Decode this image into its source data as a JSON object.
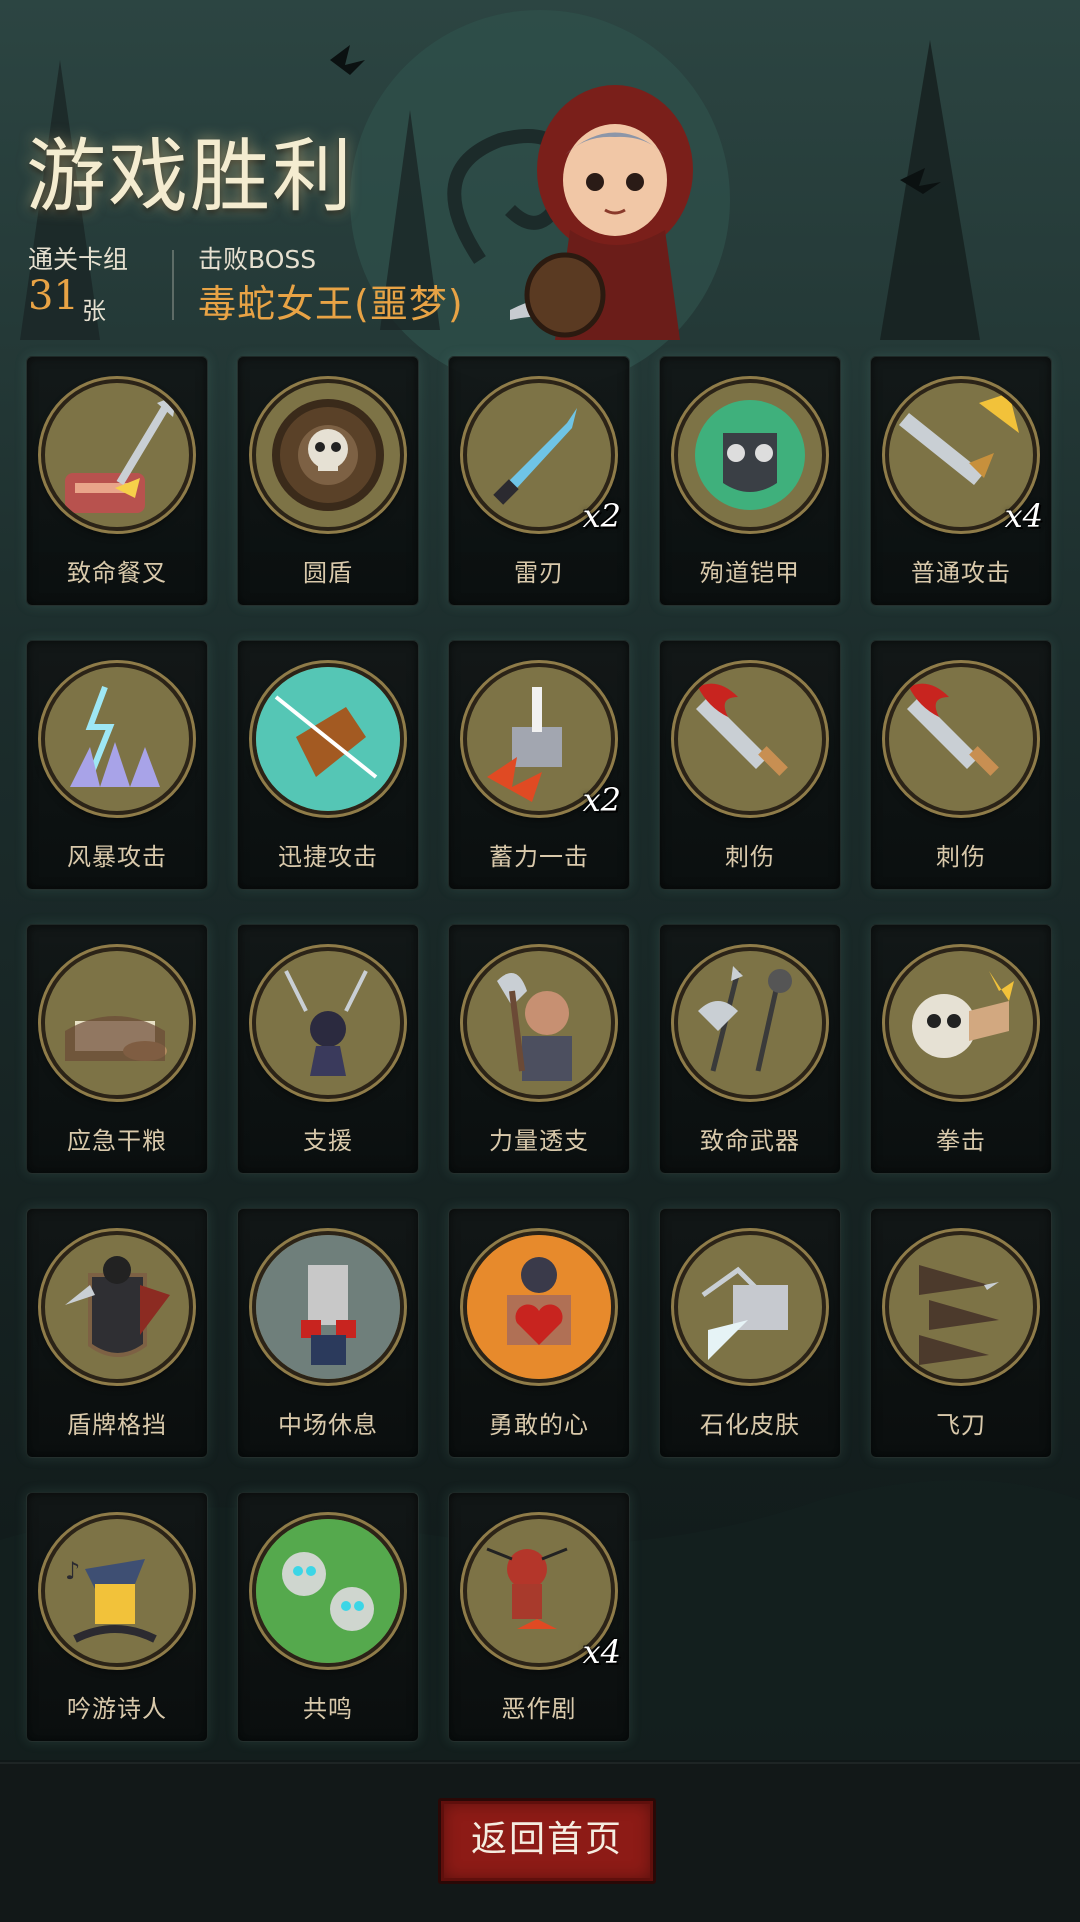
{
  "header": {
    "title": "游戏胜利",
    "deck_label": "通关卡组",
    "deck_count": "31",
    "deck_unit": "张",
    "boss_label": "击败BOSS",
    "boss_name": "毒蛇女王(噩梦)"
  },
  "cards": [
    {
      "name": "致命餐叉",
      "count": "",
      "icon": "fork-icon"
    },
    {
      "name": "圆盾",
      "count": "",
      "icon": "round-shield-icon"
    },
    {
      "name": "雷刃",
      "count": "x2",
      "icon": "thunder-blade-icon"
    },
    {
      "name": "殉道铠甲",
      "count": "",
      "icon": "martyr-armor-icon"
    },
    {
      "name": "普通攻击",
      "count": "x4",
      "icon": "sword-icon"
    },
    {
      "name": "风暴攻击",
      "count": "",
      "icon": "storm-icon"
    },
    {
      "name": "迅捷攻击",
      "count": "",
      "icon": "swift-strike-icon"
    },
    {
      "name": "蓄力一击",
      "count": "x2",
      "icon": "hammer-icon"
    },
    {
      "name": "刺伤",
      "count": "",
      "icon": "bloody-dagger-icon"
    },
    {
      "name": "刺伤",
      "count": "",
      "icon": "bloody-dagger-icon"
    },
    {
      "name": "应急干粮",
      "count": "",
      "icon": "rations-icon"
    },
    {
      "name": "支援",
      "count": "",
      "icon": "support-icon"
    },
    {
      "name": "力量透支",
      "count": "",
      "icon": "axe-man-icon"
    },
    {
      "name": "致命武器",
      "count": "",
      "icon": "weapons-icon"
    },
    {
      "name": "拳击",
      "count": "",
      "icon": "punch-skull-icon"
    },
    {
      "name": "盾牌格挡",
      "count": "",
      "icon": "shield-knight-icon"
    },
    {
      "name": "中场休息",
      "count": "",
      "icon": "boxer-rest-icon"
    },
    {
      "name": "勇敢的心",
      "count": "",
      "icon": "brave-heart-icon"
    },
    {
      "name": "石化皮肤",
      "count": "",
      "icon": "stone-fist-icon"
    },
    {
      "name": "飞刀",
      "count": "",
      "icon": "throwing-knives-icon"
    },
    {
      "name": "吟游诗人",
      "count": "",
      "icon": "bard-icon"
    },
    {
      "name": "共鸣",
      "count": "",
      "icon": "resonance-skulls-icon"
    },
    {
      "name": "恶作剧",
      "count": "x4",
      "icon": "voodoo-doll-icon"
    }
  ],
  "footer": {
    "home_button": "返回首页"
  },
  "colors": {
    "accent": "#e8a345",
    "title": "#f4ecd0",
    "card_label": "#d9c9ab",
    "icon_bg": "#7d7346",
    "button": "#8d1b16"
  }
}
